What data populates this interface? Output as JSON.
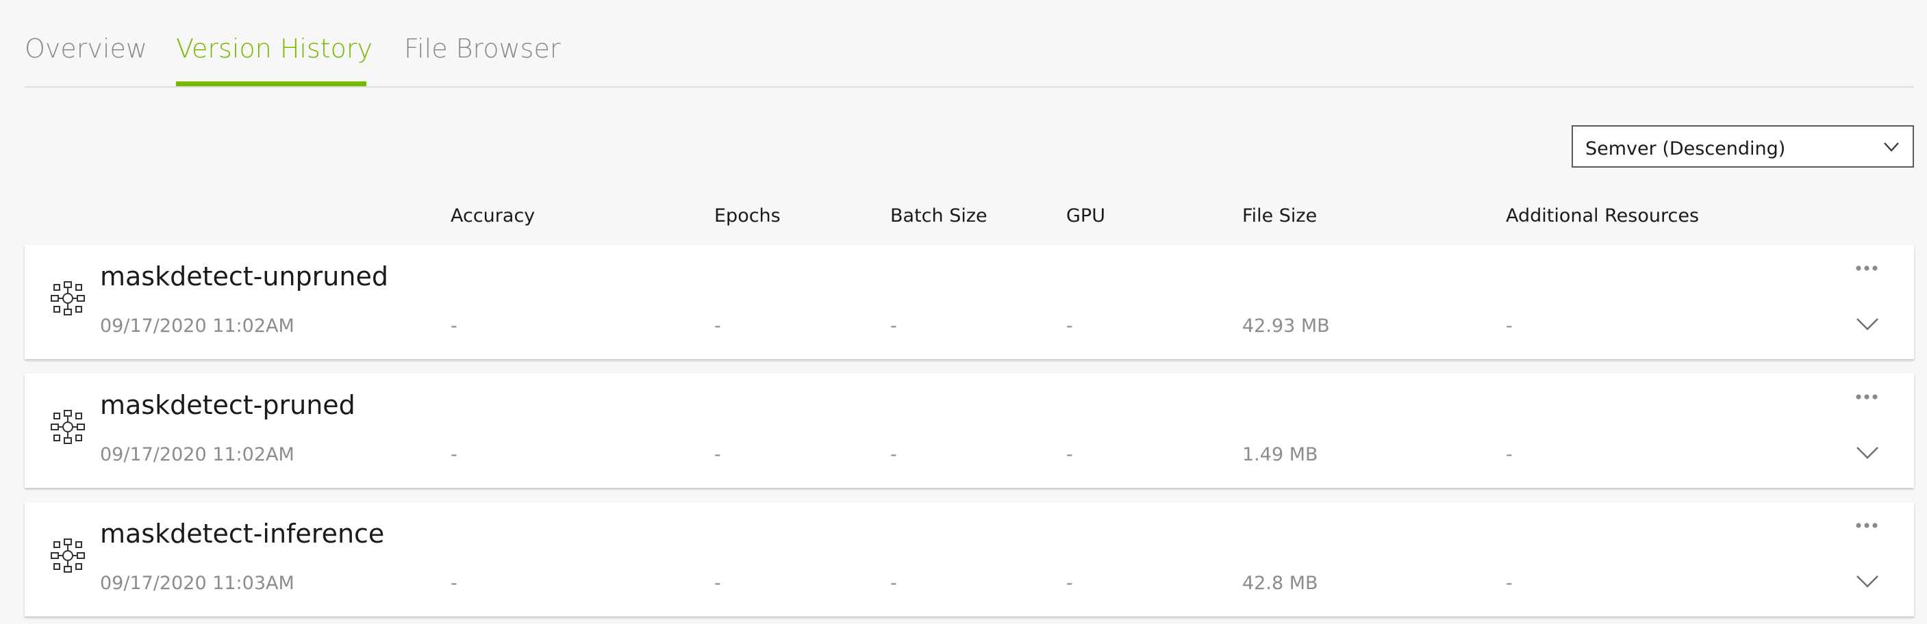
{
  "tabs": [
    {
      "label": "Overview",
      "active": false
    },
    {
      "label": "Version History",
      "active": true
    },
    {
      "label": "File Browser",
      "active": false
    }
  ],
  "sort": {
    "selected": "Semver (Descending)",
    "icon": "chevron-down-icon"
  },
  "columns": [
    "Accuracy",
    "Epochs",
    "Batch Size",
    "GPU",
    "File Size",
    "Additional Resources"
  ],
  "versions": [
    {
      "name": "maskdetect-unpruned",
      "date": "09/17/2020 11:02AM",
      "accuracy": "-",
      "epochs": "-",
      "batch_size": "-",
      "gpu": "-",
      "file_size": "42.93 MB",
      "additional_resources": "-"
    },
    {
      "name": "maskdetect-pruned",
      "date": "09/17/2020 11:02AM",
      "accuracy": "-",
      "epochs": "-",
      "batch_size": "-",
      "gpu": "-",
      "file_size": "1.49 MB",
      "additional_resources": "-"
    },
    {
      "name": "maskdetect-inference",
      "date": "09/17/2020 11:03AM",
      "accuracy": "-",
      "epochs": "-",
      "batch_size": "-",
      "gpu": "-",
      "file_size": "42.8 MB",
      "additional_resources": "-"
    }
  ],
  "colors": {
    "accent": "#76b900",
    "muted_text": "#8c8c8c",
    "background": "#f7f7f7"
  },
  "icons": {
    "model": "model-network-icon",
    "more": "more-options-icon",
    "expand": "chevron-down-icon"
  }
}
